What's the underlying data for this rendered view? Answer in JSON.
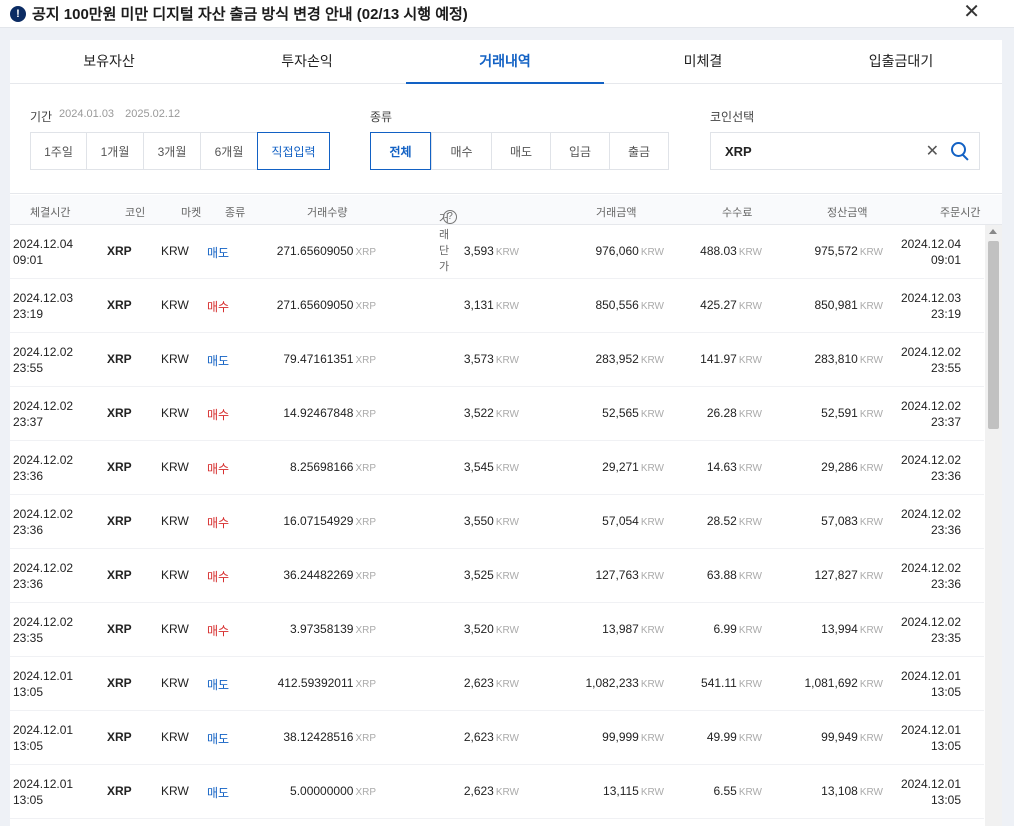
{
  "notice": {
    "icon": "exclamation-icon",
    "text": "공지 100만원 미만 디지털 자산 출금 방식 변경 안내 (02/13 시행 예정)"
  },
  "tabs": [
    "보유자산",
    "투자손익",
    "거래내역",
    "미체결",
    "입출금대기"
  ],
  "active_tab": "거래내역",
  "filters": {
    "period_label": "기간",
    "date_from": "2024.01.03",
    "date_to": "2025.02.12",
    "period_buttons": [
      "1주일",
      "1개월",
      "3개월",
      "6개월",
      "직접입력"
    ],
    "period_selected": "직접입력",
    "type_label": "종류",
    "type_buttons": [
      "전체",
      "매수",
      "매도",
      "입금",
      "출금"
    ],
    "type_selected": "전체",
    "coin_label": "코인선택",
    "coin_value": "XRP"
  },
  "columns": [
    "체결시간",
    "코인",
    "마켓",
    "종류",
    "거래수량",
    "거래단가",
    "거래금액",
    "수수료",
    "정산금액",
    "주문시간"
  ],
  "units": {
    "qty": "XRP",
    "krw": "KRW"
  },
  "rows": [
    {
      "date": "2024.12.04",
      "time": "09:01",
      "coin": "XRP",
      "market": "KRW",
      "type": "매도",
      "qty": "271.65609050",
      "price": "3,593",
      "total": "976,060",
      "fee": "488.03",
      "settle": "975,572",
      "odate": "2024.12.04",
      "otime": "09:01"
    },
    {
      "date": "2024.12.03",
      "time": "23:19",
      "coin": "XRP",
      "market": "KRW",
      "type": "매수",
      "qty": "271.65609050",
      "price": "3,131",
      "total": "850,556",
      "fee": "425.27",
      "settle": "850,981",
      "odate": "2024.12.03",
      "otime": "23:19"
    },
    {
      "date": "2024.12.02",
      "time": "23:55",
      "coin": "XRP",
      "market": "KRW",
      "type": "매도",
      "qty": "79.47161351",
      "price": "3,573",
      "total": "283,952",
      "fee": "141.97",
      "settle": "283,810",
      "odate": "2024.12.02",
      "otime": "23:55"
    },
    {
      "date": "2024.12.02",
      "time": "23:37",
      "coin": "XRP",
      "market": "KRW",
      "type": "매수",
      "qty": "14.92467848",
      "price": "3,522",
      "total": "52,565",
      "fee": "26.28",
      "settle": "52,591",
      "odate": "2024.12.02",
      "otime": "23:37"
    },
    {
      "date": "2024.12.02",
      "time": "23:36",
      "coin": "XRP",
      "market": "KRW",
      "type": "매수",
      "qty": "8.25698166",
      "price": "3,545",
      "total": "29,271",
      "fee": "14.63",
      "settle": "29,286",
      "odate": "2024.12.02",
      "otime": "23:36"
    },
    {
      "date": "2024.12.02",
      "time": "23:36",
      "coin": "XRP",
      "market": "KRW",
      "type": "매수",
      "qty": "16.07154929",
      "price": "3,550",
      "total": "57,054",
      "fee": "28.52",
      "settle": "57,083",
      "odate": "2024.12.02",
      "otime": "23:36"
    },
    {
      "date": "2024.12.02",
      "time": "23:36",
      "coin": "XRP",
      "market": "KRW",
      "type": "매수",
      "qty": "36.24482269",
      "price": "3,525",
      "total": "127,763",
      "fee": "63.88",
      "settle": "127,827",
      "odate": "2024.12.02",
      "otime": "23:36"
    },
    {
      "date": "2024.12.02",
      "time": "23:35",
      "coin": "XRP",
      "market": "KRW",
      "type": "매수",
      "qty": "3.97358139",
      "price": "3,520",
      "total": "13,987",
      "fee": "6.99",
      "settle": "13,994",
      "odate": "2024.12.02",
      "otime": "23:35"
    },
    {
      "date": "2024.12.01",
      "time": "13:05",
      "coin": "XRP",
      "market": "KRW",
      "type": "매도",
      "qty": "412.59392011",
      "price": "2,623",
      "total": "1,082,233",
      "fee": "541.11",
      "settle": "1,081,692",
      "odate": "2024.12.01",
      "otime": "13:05"
    },
    {
      "date": "2024.12.01",
      "time": "13:05",
      "coin": "XRP",
      "market": "KRW",
      "type": "매도",
      "qty": "38.12428516",
      "price": "2,623",
      "total": "99,999",
      "fee": "49.99",
      "settle": "99,949",
      "odate": "2024.12.01",
      "otime": "13:05"
    },
    {
      "date": "2024.12.01",
      "time": "13:05",
      "coin": "XRP",
      "market": "KRW",
      "type": "매도",
      "qty": "5.00000000",
      "price": "2,623",
      "total": "13,115",
      "fee": "6.55",
      "settle": "13,108",
      "odate": "2024.12.01",
      "otime": "13:05"
    }
  ],
  "colors": {
    "accent": "#1261c4",
    "buy": "#d62b2b",
    "sell": "#1261c4"
  }
}
